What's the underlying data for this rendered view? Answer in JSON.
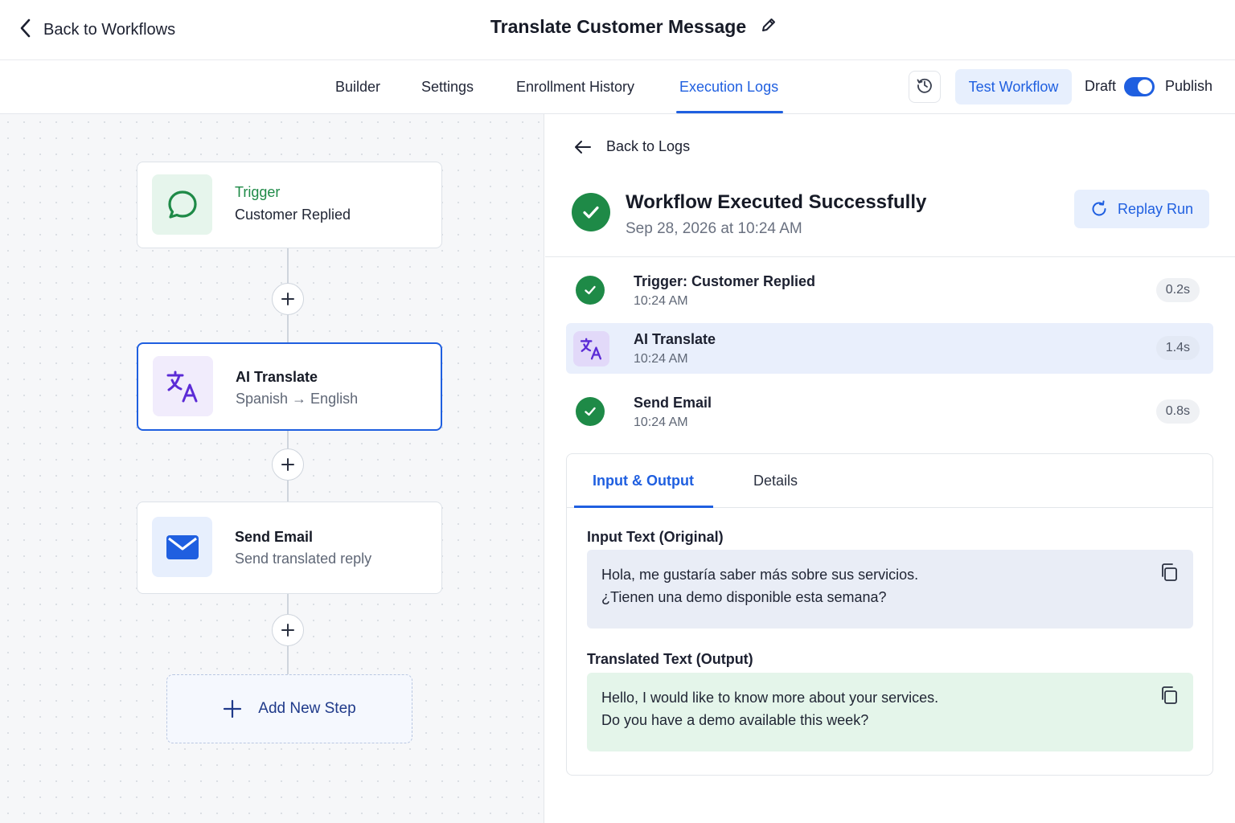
{
  "header": {
    "back_label": "Back to Workflows",
    "title": "Translate Customer Message"
  },
  "tabs": [
    {
      "label": "Builder"
    },
    {
      "label": "Settings"
    },
    {
      "label": "Enrollment History"
    },
    {
      "label": "Execution Logs"
    }
  ],
  "active_tab": "Execution Logs",
  "toolbar": {
    "test_label": "Test Workflow",
    "draft_label": "Draft",
    "publish_label": "Publish",
    "publish_toggle_on": true
  },
  "canvas": {
    "nodes": [
      {
        "kind": "trigger",
        "title": "Trigger",
        "subtitle": "Customer Replied",
        "icon": "chat-bubble-icon"
      },
      {
        "kind": "action",
        "title": "AI Translate",
        "subtitle": "Spanish → English",
        "icon": "translate-icon",
        "selected": true
      },
      {
        "kind": "action",
        "title": "Send Email",
        "subtitle": "Send translated reply",
        "icon": "envelope-icon"
      }
    ],
    "add_step_label": "Add New Step"
  },
  "log": {
    "back_label": "Back to Logs",
    "status_title": "Workflow Executed Successfully",
    "status_time": "Sep 28, 2026 at 10:24 AM",
    "replay_label": "Replay Run",
    "steps": [
      {
        "name": "Trigger: Customer Replied",
        "time": "10:24 AM",
        "duration": "0.2s",
        "status": "success"
      },
      {
        "name": "AI Translate",
        "time": "10:24 AM",
        "duration": "1.4s",
        "status": "active"
      },
      {
        "name": "Send Email",
        "time": "10:24 AM",
        "duration": "0.8s",
        "status": "success"
      }
    ],
    "detail_tabs": [
      "Input & Output",
      "Details"
    ],
    "input_label": "Input Text (Original)",
    "input_lines": [
      "Hola, me gustaría saber más sobre sus servicios.",
      "¿Tienen una demo disponible esta semana?"
    ],
    "output_label": "Translated Text (Output)",
    "output_lines": [
      "Hello, I would like to know more about your services.",
      "Do you have a demo available this week?"
    ]
  },
  "colors": {
    "accent": "#1f5fe0",
    "success": "#1e8a47",
    "trigger_green": "#1e8a47",
    "translate_purple": "#5b2bd6"
  }
}
